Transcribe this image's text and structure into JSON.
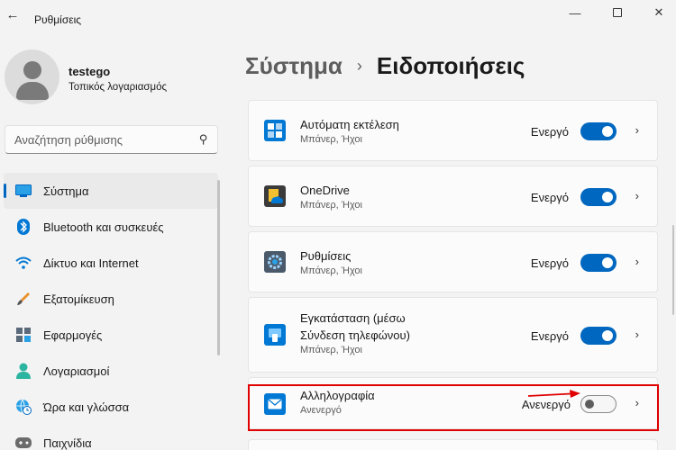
{
  "window": {
    "title": "Ρυθμίσεις",
    "minimize": "—",
    "close": "✕"
  },
  "user": {
    "name": "testego",
    "account_type": "Τοπικός λογαριασμός"
  },
  "search": {
    "placeholder": "Αναζήτηση ρύθμισης"
  },
  "sidebar": {
    "items": [
      {
        "label": "Σύστημα",
        "icon": "system-display-icon",
        "active": true
      },
      {
        "label": "Bluetooth και συσκευές",
        "icon": "bluetooth-icon"
      },
      {
        "label": "Δίκτυο και Internet",
        "icon": "wifi-icon"
      },
      {
        "label": "Εξατομίκευση",
        "icon": "paintbrush-icon"
      },
      {
        "label": "Εφαρμογές",
        "icon": "apps-icon"
      },
      {
        "label": "Λογαριασμοί",
        "icon": "person-icon"
      },
      {
        "label": "Ώρα και γλώσσα",
        "icon": "globe-clock-icon"
      },
      {
        "label": "Παιχνίδια",
        "icon": "gamepad-icon"
      }
    ]
  },
  "breadcrumb": {
    "parent": "Σύστημα",
    "separator": "›",
    "current": "Ειδοποιήσεις"
  },
  "apps": [
    {
      "title": "Αυτόματη εκτέλεση",
      "subtitle": "Μπάνερ, Ήχοι",
      "status": "Ενεργό",
      "enabled": true,
      "icon": "autoplay-icon"
    },
    {
      "title": "OneDrive",
      "subtitle": "Μπάνερ, Ήχοι",
      "status": "Ενεργό",
      "enabled": true,
      "icon": "onedrive-icon"
    },
    {
      "title": "Ρυθμίσεις",
      "subtitle": "Μπάνερ, Ήχοι",
      "status": "Ενεργό",
      "enabled": true,
      "icon": "settings-gear-icon"
    },
    {
      "title_line1": "Εγκατάσταση (μέσω",
      "title_line2": "Σύνδεση τηλεφώνου)",
      "subtitle": "Μπάνερ, Ήχοι",
      "status": "Ενεργό",
      "enabled": true,
      "icon": "phone-link-icon"
    },
    {
      "title": "Αλληλογραφία",
      "subtitle": "Ανενεργό",
      "status": "Ανενεργό",
      "enabled": false,
      "icon": "mail-icon"
    }
  ],
  "colors": {
    "accent": "#0067c0",
    "highlight": "#e00000"
  }
}
